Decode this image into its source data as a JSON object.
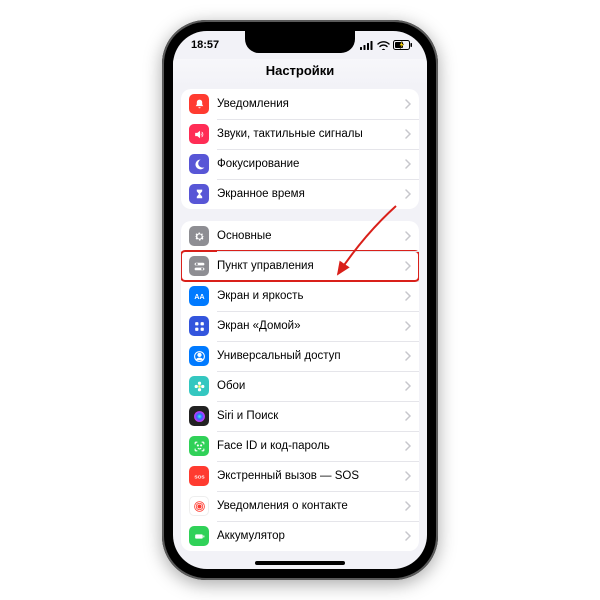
{
  "status": {
    "time": "18:57"
  },
  "header": {
    "title": "Настройки"
  },
  "group1": [
    {
      "name": "notifications",
      "label": "Уведомления",
      "color": "#ff3b30",
      "icon": "bell"
    },
    {
      "name": "sounds",
      "label": "Звуки, тактильные сигналы",
      "color": "#ff2d55",
      "icon": "speaker"
    },
    {
      "name": "focus",
      "label": "Фокусирование",
      "color": "#5856d6",
      "icon": "moon"
    },
    {
      "name": "screentime",
      "label": "Экранное время",
      "color": "#5856d6",
      "icon": "hourglass"
    }
  ],
  "group2": [
    {
      "name": "general",
      "label": "Основные",
      "color": "#8e8e93",
      "icon": "gear"
    },
    {
      "name": "control-center",
      "label": "Пункт управления",
      "color": "#8e8e93",
      "icon": "switches",
      "highlight": true
    },
    {
      "name": "display",
      "label": "Экран и яркость",
      "color": "#007aff",
      "icon": "aa"
    },
    {
      "name": "home-screen",
      "label": "Экран «Домой»",
      "color": "#3355dd",
      "icon": "grid"
    },
    {
      "name": "accessibility",
      "label": "Универсальный доступ",
      "color": "#007aff",
      "icon": "person"
    },
    {
      "name": "wallpaper",
      "label": "Обои",
      "color": "#34c7c0",
      "icon": "flower"
    },
    {
      "name": "siri",
      "label": "Siri и Поиск",
      "color": "#222",
      "icon": "siri"
    },
    {
      "name": "faceid",
      "label": "Face ID и код-пароль",
      "color": "#30d158",
      "icon": "face"
    },
    {
      "name": "sos",
      "label": "Экстренный вызов — SOS",
      "color": "#ff3b30",
      "icon": "sos"
    },
    {
      "name": "exposure",
      "label": "Уведомления о контакте",
      "color": "#fff",
      "icon": "exposure"
    },
    {
      "name": "battery",
      "label": "Аккумулятор",
      "color": "#30d158",
      "icon": "battery"
    }
  ]
}
